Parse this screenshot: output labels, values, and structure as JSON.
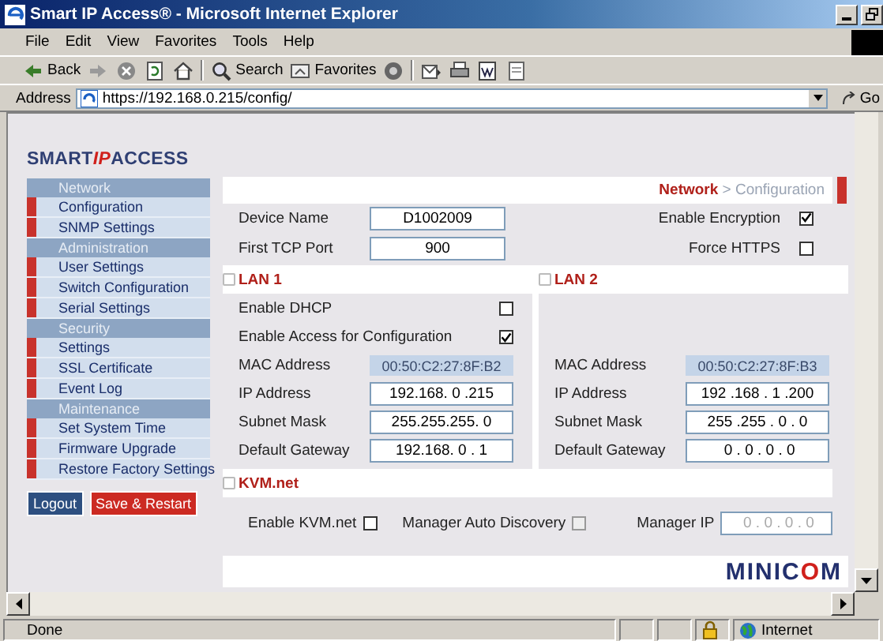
{
  "window": {
    "title": "Smart IP Access® - Microsoft Internet Explorer"
  },
  "menu": [
    "File",
    "Edit",
    "View",
    "Favorites",
    "Tools",
    "Help"
  ],
  "toolbar": [
    {
      "kind": "back",
      "label": "Back"
    },
    {
      "kind": "forward"
    },
    {
      "kind": "stop"
    },
    {
      "kind": "refresh"
    },
    {
      "kind": "home"
    },
    {
      "kind": "search",
      "label": "Search"
    },
    {
      "kind": "favorites",
      "label": "Favorites"
    },
    {
      "kind": "media"
    },
    {
      "kind": "mail"
    },
    {
      "kind": "print"
    },
    {
      "kind": "edit"
    },
    {
      "kind": "discuss"
    }
  ],
  "address": {
    "label": "Address",
    "value": "https://192.168.0.215/config/",
    "go": "Go"
  },
  "page": {
    "logo": [
      "SMART",
      "IP",
      "ACCESS"
    ],
    "sidebar": [
      {
        "title": "Network",
        "items": [
          "Configuration",
          "SNMP Settings"
        ]
      },
      {
        "title": "Administration",
        "items": [
          "User Settings",
          "Switch Configuration",
          "Serial Settings"
        ]
      },
      {
        "title": "Security",
        "items": [
          "Settings",
          "SSL Certificate",
          "Event Log"
        ]
      },
      {
        "title": "Maintenance",
        "items": [
          "Set System Time",
          "Firmware Upgrade",
          "Restore Factory Settings"
        ]
      }
    ],
    "buttons": [
      {
        "label": "Logout",
        "kind": "primary"
      },
      {
        "label": "Save & Restart",
        "kind": "danger"
      }
    ],
    "breadcrumb": {
      "section": "Network",
      "page": "> Configuration"
    },
    "general": {
      "fields": [
        {
          "label": "Device Name",
          "value": "D1002009"
        },
        {
          "label": "First TCP Port",
          "value": "900"
        }
      ],
      "options": [
        {
          "label": "Enable Encryption",
          "checked": true
        },
        {
          "label": "Force HTTPS",
          "checked": false
        }
      ]
    },
    "lans": [
      {
        "title": "LAN 1",
        "options": [
          {
            "label": "Enable DHCP",
            "checked": false
          },
          {
            "label": "Enable Access for Configuration",
            "checked": true
          }
        ],
        "mac": {
          "label": "MAC Address",
          "value": "00:50:C2:27:8F:B2"
        },
        "fields": [
          {
            "label": "IP Address",
            "value": "192.168. 0 .215"
          },
          {
            "label": "Subnet Mask",
            "value": "255.255.255. 0"
          },
          {
            "label": "Default Gateway",
            "value": "192.168. 0 . 1"
          }
        ]
      },
      {
        "title": "LAN 2",
        "mac": {
          "label": "MAC Address",
          "value": "00:50:C2:27:8F:B3"
        },
        "fields": [
          {
            "label": "IP Address",
            "value": "192 .168 . 1 .200"
          },
          {
            "label": "Subnet Mask",
            "value": "255 .255 . 0 . 0"
          },
          {
            "label": "Default Gateway",
            "value": " 0 . 0 . 0 . 0"
          }
        ]
      }
    ],
    "kvm": {
      "title": "KVM.net",
      "enable": {
        "label": "Enable KVM.net",
        "checked": false,
        "disabled": false
      },
      "discovery": {
        "label": "Manager Auto Discovery",
        "checked": false,
        "disabled": true
      },
      "manager_ip": {
        "label": "Manager IP",
        "value": " 0 . 0 . 0 . 0",
        "disabled": true
      }
    },
    "footer_logo": [
      "MINIC",
      "O",
      "M"
    ]
  },
  "status": {
    "text": "Done",
    "zone": "Internet"
  }
}
